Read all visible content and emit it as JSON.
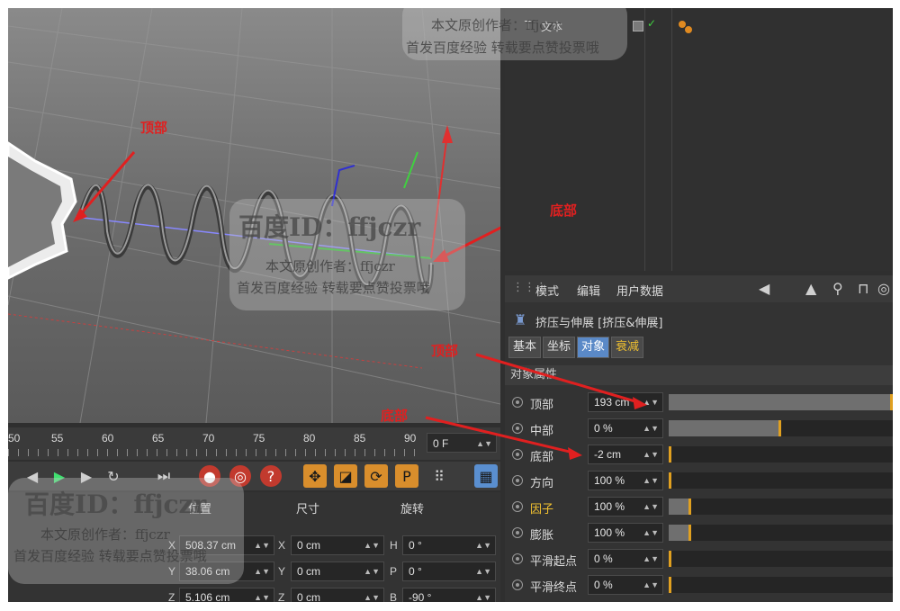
{
  "viewport": {
    "annotations": [
      "顶部",
      "底部"
    ]
  },
  "timeline": {
    "ticks": [
      "50",
      "55",
      "60",
      "65",
      "70",
      "75",
      "80",
      "85",
      "90"
    ],
    "current_frame": "0 F"
  },
  "coord_manager": {
    "headers": [
      "位置",
      "尺寸",
      "旋转"
    ],
    "rows": [
      {
        "axis": "X",
        "pos": "508.37 cm",
        "size_axis": "X",
        "size": "0 cm",
        "rot_axis": "H",
        "rot": "0 °"
      },
      {
        "axis": "Y",
        "pos": "38.06 cm",
        "size_axis": "Y",
        "size": "0 cm",
        "rot_axis": "P",
        "rot": "0 °"
      },
      {
        "axis": "Z",
        "pos": "5.106 cm",
        "size_axis": "Z",
        "size": "0 cm",
        "rot_axis": "B",
        "rot": "-90 °"
      }
    ]
  },
  "object_manager": {
    "item_label": "文本"
  },
  "attribute_manager": {
    "menu": [
      "模式",
      "编辑",
      "用户数据"
    ],
    "title": "挤压与伸展 [挤压&伸展]",
    "tabs": [
      "基本",
      "坐标",
      "对象",
      "衰减"
    ],
    "section": "对象属性",
    "params": [
      {
        "label": "顶部",
        "value": "193 cm",
        "fill": 1.0,
        "highlight": false
      },
      {
        "label": "中部",
        "value": "0 %",
        "fill": 0.5,
        "highlight": false
      },
      {
        "label": "底部",
        "value": "-2 cm",
        "fill": 0.0,
        "highlight": false
      },
      {
        "label": "方向",
        "value": "100 %",
        "fill": 0.0,
        "highlight": false
      },
      {
        "label": "因子",
        "value": "100 %",
        "fill": 0.1,
        "highlight": true
      },
      {
        "label": "膨胀",
        "value": "100 %",
        "fill": 0.1,
        "highlight": false
      },
      {
        "label": "平滑起点",
        "value": "0 %",
        "fill": 0.0,
        "highlight": false
      },
      {
        "label": "平滑终点",
        "value": "0 %",
        "fill": 0.0,
        "highlight": false
      }
    ],
    "annotations": [
      "顶部",
      "底部"
    ]
  },
  "watermark": {
    "id_text": "百度ID：ffjczr",
    "line1": "本文原创作者：ffjczr",
    "line2": "首发百度经验  转载要点赞投票哦"
  },
  "colors": {
    "accent": "#5a89c7",
    "annotation": "#e02020",
    "highlight_label": "#f0c030",
    "slider_knob": "#e0a020"
  }
}
